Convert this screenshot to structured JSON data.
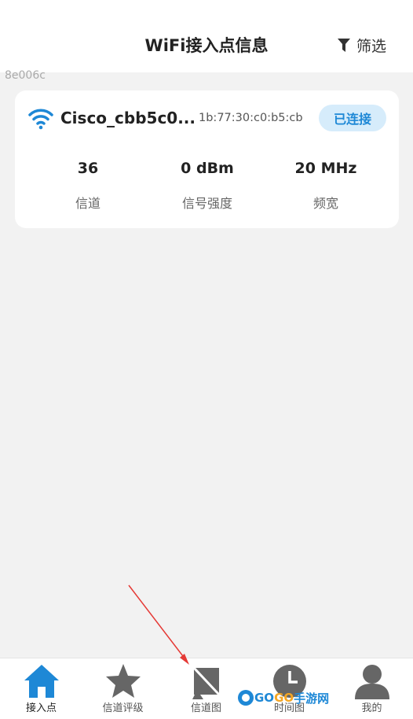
{
  "header": {
    "title": "WiFi接入点信息",
    "filter_label": "筛选"
  },
  "watermark_top": "8e006c",
  "network": {
    "ssid": "Cisco_cbb5c0...",
    "bssid": "1b:77:30:c0:b5:cb",
    "status": "已连接",
    "stats": [
      {
        "value": "36",
        "label": "信道"
      },
      {
        "value": "0 dBm",
        "label": "信号强度"
      },
      {
        "value": "20 MHz",
        "label": "频宽"
      }
    ]
  },
  "nav": [
    {
      "label": "接入点",
      "icon": "home-icon",
      "active": true
    },
    {
      "label": "信道评级",
      "icon": "star-icon",
      "active": false
    },
    {
      "label": "信道图",
      "icon": "satellite-dish-icon",
      "active": false
    },
    {
      "label": "时间图",
      "icon": "clock-icon",
      "active": false
    },
    {
      "label": "我的",
      "icon": "user-icon",
      "active": false
    }
  ],
  "logo_watermark": {
    "part1": "GO",
    "part2": "GO",
    "part3": "手游网"
  },
  "colors": {
    "accent": "#1e88d6",
    "badge_bg": "#d6ecfb",
    "nav_inactive": "#666666",
    "background": "#f2f2f2"
  }
}
